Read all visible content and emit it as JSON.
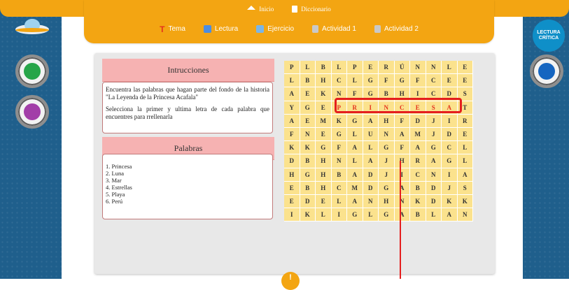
{
  "nav": {
    "top_items": [
      {
        "label": "Inicio",
        "icon": "home-icon"
      },
      {
        "label": "Diccionario",
        "icon": "dictionary-icon"
      }
    ],
    "items": [
      {
        "label": "Tema",
        "icon": "tema-icon"
      },
      {
        "label": "Lectura",
        "icon": "lectura-icon"
      },
      {
        "label": "Ejercicio",
        "icon": "ejercicio-icon"
      },
      {
        "label": "Actividad 1",
        "icon": "activity-icon"
      },
      {
        "label": "Actividad 2",
        "icon": "activity-icon"
      }
    ],
    "tema_glyph": "T"
  },
  "right_badge": {
    "line1": "LECTURA",
    "line2": "CRÍTICA"
  },
  "instructions": {
    "title": "Intrucciones",
    "p1": "Encuentra las palabras que hagan parte del fondo de la historia \"La Leyenda de la Princesa Acafala\"",
    "p2": "Selecciona la primer y ultima letra de cada palabra que encuentres para rrellenarla"
  },
  "words": {
    "title": "Palabras",
    "list": [
      "1. Princesa",
      "2. Luna",
      "3. Mar",
      "4. Estrellas",
      "5. Playa",
      "6. Perú"
    ]
  },
  "grid": [
    [
      "P",
      "L",
      "B",
      "L",
      "P",
      "E",
      "R",
      "Ú",
      "N",
      "N",
      "L",
      "E"
    ],
    [
      "L",
      "B",
      "H",
      "C",
      "L",
      "G",
      "F",
      "G",
      "F",
      "C",
      "E",
      "E"
    ],
    [
      "A",
      "E",
      "K",
      "N",
      "F",
      "G",
      "B",
      "H",
      "I",
      "C",
      "D",
      "S"
    ],
    [
      "Y",
      "G",
      "E",
      "P",
      "R",
      "I",
      "N",
      "C",
      "E",
      "S",
      "A",
      "T"
    ],
    [
      "A",
      "E",
      "M",
      "K",
      "G",
      "A",
      "H",
      "F",
      "D",
      "J",
      "I",
      "R"
    ],
    [
      "F",
      "N",
      "E",
      "G",
      "L",
      "U",
      "N",
      "A",
      "M",
      "J",
      "D",
      "E"
    ],
    [
      "K",
      "K",
      "G",
      "F",
      "A",
      "L",
      "G",
      "F",
      "A",
      "G",
      "C",
      "L"
    ],
    [
      "D",
      "B",
      "H",
      "N",
      "L",
      "A",
      "J",
      "H",
      "R",
      "A",
      "G",
      "L"
    ],
    [
      "H",
      "G",
      "H",
      "B",
      "A",
      "D",
      "J",
      "I",
      "C",
      "N",
      "I",
      "A"
    ],
    [
      "E",
      "B",
      "H",
      "C",
      "M",
      "D",
      "G",
      "A",
      "B",
      "D",
      "J",
      "S"
    ],
    [
      "E",
      "D",
      "E",
      "L",
      "A",
      "N",
      "H",
      "N",
      "K",
      "D",
      "K",
      "K"
    ],
    [
      "I",
      "K",
      "L",
      "I",
      "G",
      "L",
      "G",
      "A",
      "B",
      "L",
      "A",
      "N"
    ]
  ],
  "highlighted": {
    "row": 3,
    "from_col": 3,
    "to_col": 10
  },
  "colors": {
    "accent": "#f3a512",
    "sidebar": "#1f5f8c",
    "highlight": "#e41e1e",
    "grid": "#fbe28d"
  },
  "bottom_badge": "!"
}
